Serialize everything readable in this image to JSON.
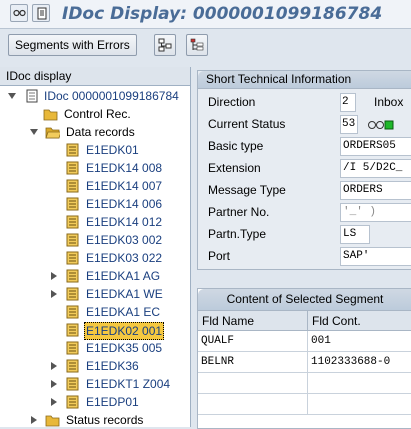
{
  "title": "IDoc Display: 0000001099186784",
  "toolbar": {
    "segments_label": "Segments with Errors"
  },
  "tree": {
    "header": "IDoc display",
    "root": "IDoc 0000001099186784",
    "control": "Control Rec.",
    "data_records": "Data records",
    "items": [
      "E1EDK01",
      "E1EDK14 008",
      "E1EDK14 007",
      "E1EDK14 006",
      "E1EDK14 012",
      "E1EDK03 002",
      "E1EDK03 022",
      "E1EDKA1 AG",
      "E1EDKA1 WE",
      "E1EDKA1 EC",
      "E1EDK02 001",
      "E1EDK35 005",
      "E1EDK36",
      "E1EDKT1 Z004",
      "E1EDP01"
    ],
    "status": "Status records"
  },
  "info": {
    "header": "Short Technical Information",
    "rows": [
      {
        "label": "Direction",
        "value": "2",
        "extra": "Inbox"
      },
      {
        "label": "Current Status",
        "value": "53"
      },
      {
        "label": "Basic type",
        "value": "ORDERS05"
      },
      {
        "label": "Extension",
        "value": "/I    5/D2C_"
      },
      {
        "label": "Message Type",
        "value": "ORDERS"
      },
      {
        "label": "Partner No.",
        "value": "     '_'    )"
      },
      {
        "label": "Partn.Type",
        "value": "LS"
      },
      {
        "label": "Port",
        "value": "SAP'"
      }
    ]
  },
  "segment": {
    "header": "Content of Selected Segment",
    "columns": [
      "Fld Name",
      "Fld Cont."
    ],
    "rows": [
      [
        "QUALF",
        "001"
      ],
      [
        "BELNR",
        "1102333688-0"
      ]
    ]
  },
  "colors": {
    "title": "#4a6c97",
    "tree_text": "#1a3f7f",
    "selection": "#f5c840",
    "folder": "#e8b83a"
  }
}
